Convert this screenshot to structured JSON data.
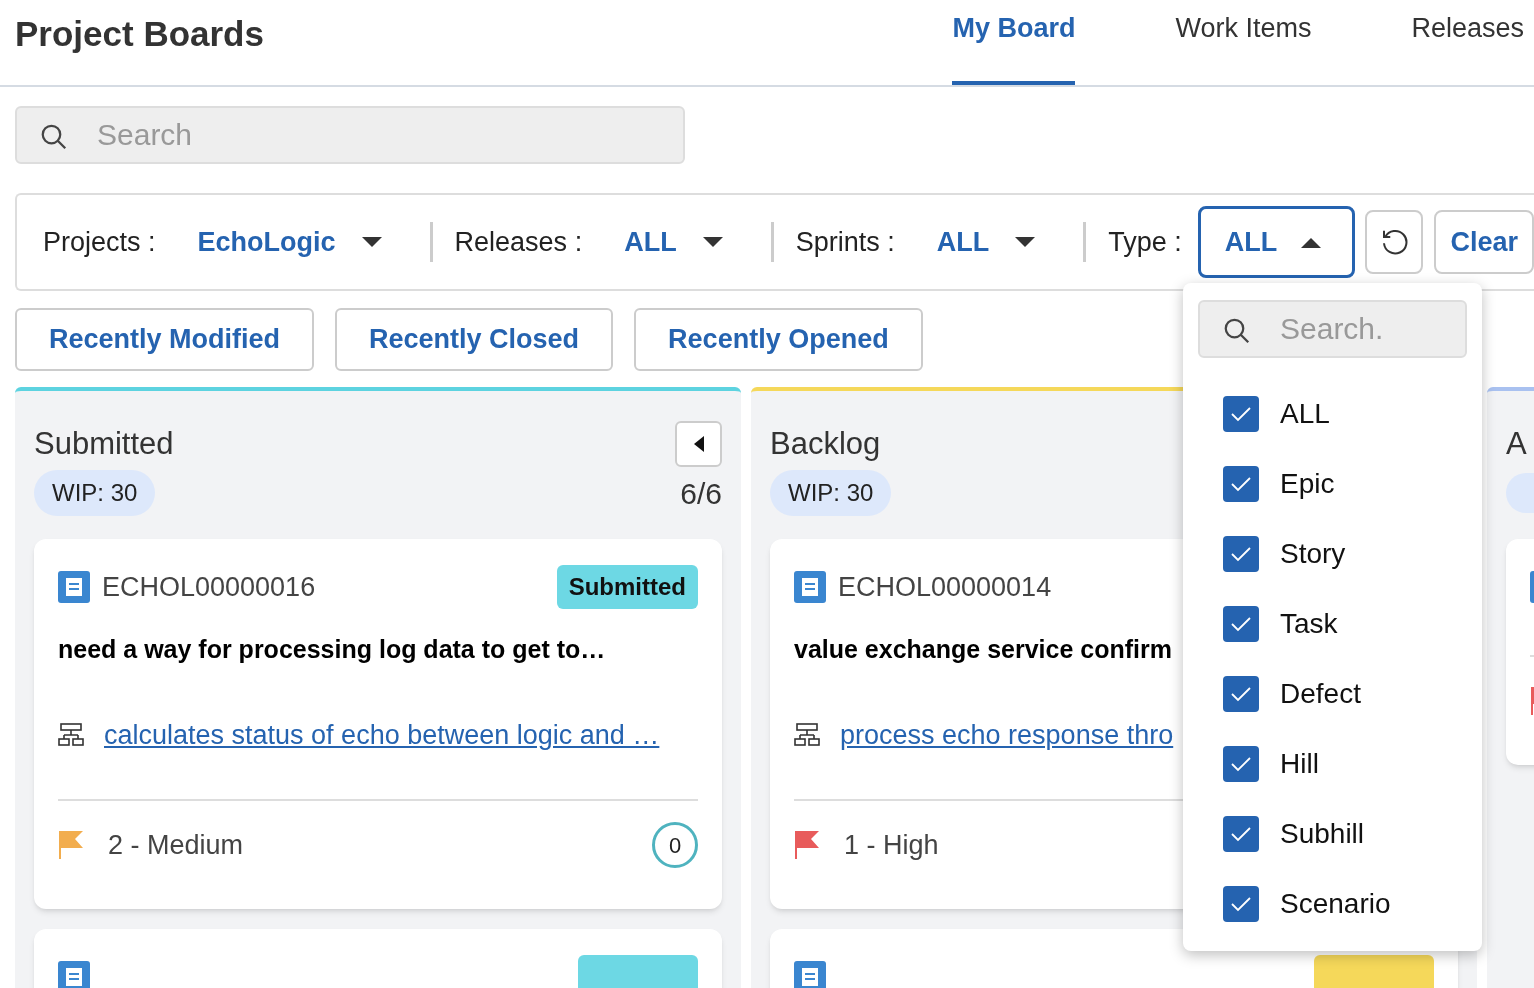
{
  "header": {
    "title": "Project Boards",
    "tabs": [
      {
        "label": "My Board",
        "selected": true
      },
      {
        "label": "Work Items",
        "selected": false
      },
      {
        "label": "Releases",
        "selected": false
      }
    ]
  },
  "search": {
    "placeholder": "Search"
  },
  "filters": [
    {
      "label": "Projects :",
      "value": "EchoLogic",
      "kind": "dropdown",
      "expanded": false
    },
    {
      "label": "Releases :",
      "value": "ALL",
      "kind": "dropdown",
      "expanded": false
    },
    {
      "label": "Sprints :",
      "value": "ALL",
      "kind": "dropdown",
      "expanded": false
    },
    {
      "label": "Type :",
      "value": "ALL",
      "kind": "select",
      "expanded": true
    }
  ],
  "clear_button": "Clear",
  "quick_filters": [
    "Recently Modified",
    "Recently Closed",
    "Recently Opened"
  ],
  "type_menu": {
    "search_placeholder": "Search.",
    "options": [
      {
        "label": "ALL",
        "checked": true
      },
      {
        "label": "Epic",
        "checked": true
      },
      {
        "label": "Story",
        "checked": true
      },
      {
        "label": "Task",
        "checked": true
      },
      {
        "label": "Defect",
        "checked": true
      },
      {
        "label": "Hill",
        "checked": true
      },
      {
        "label": "Subhill",
        "checked": true
      },
      {
        "label": "Scenario",
        "checked": true
      }
    ]
  },
  "columns": [
    {
      "title": "Submitted",
      "wip": "WIP: 30",
      "count": "6/6",
      "color": "#5dd3e0",
      "cards": [
        {
          "id": "ECHOL00000016",
          "status": {
            "label": "Submitted",
            "color": "#6dd8e4"
          },
          "title": "need a way for processing log data to get to…",
          "link": "calculates status of echo between logic and …",
          "priority": {
            "label": "2 - Medium",
            "color": "#f2ad4e"
          },
          "comments": "0"
        },
        {
          "status": {
            "color": "#6dd8e4"
          }
        }
      ]
    },
    {
      "title": "Backlog",
      "wip": "WIP: 30",
      "color": "#f5d85a",
      "cards": [
        {
          "id": "ECHOL00000014",
          "title": "value exchange service confirm",
          "link": "process echo response thro",
          "priority": {
            "label": "1 - High",
            "color": "#e85b5b"
          }
        },
        {
          "status": {
            "color": "#f5d85a"
          }
        }
      ]
    },
    {
      "title": "A",
      "color": "#a9c1f0",
      "cards": [
        {
          "priority": {
            "color": "#e85b5b"
          }
        }
      ]
    }
  ]
}
